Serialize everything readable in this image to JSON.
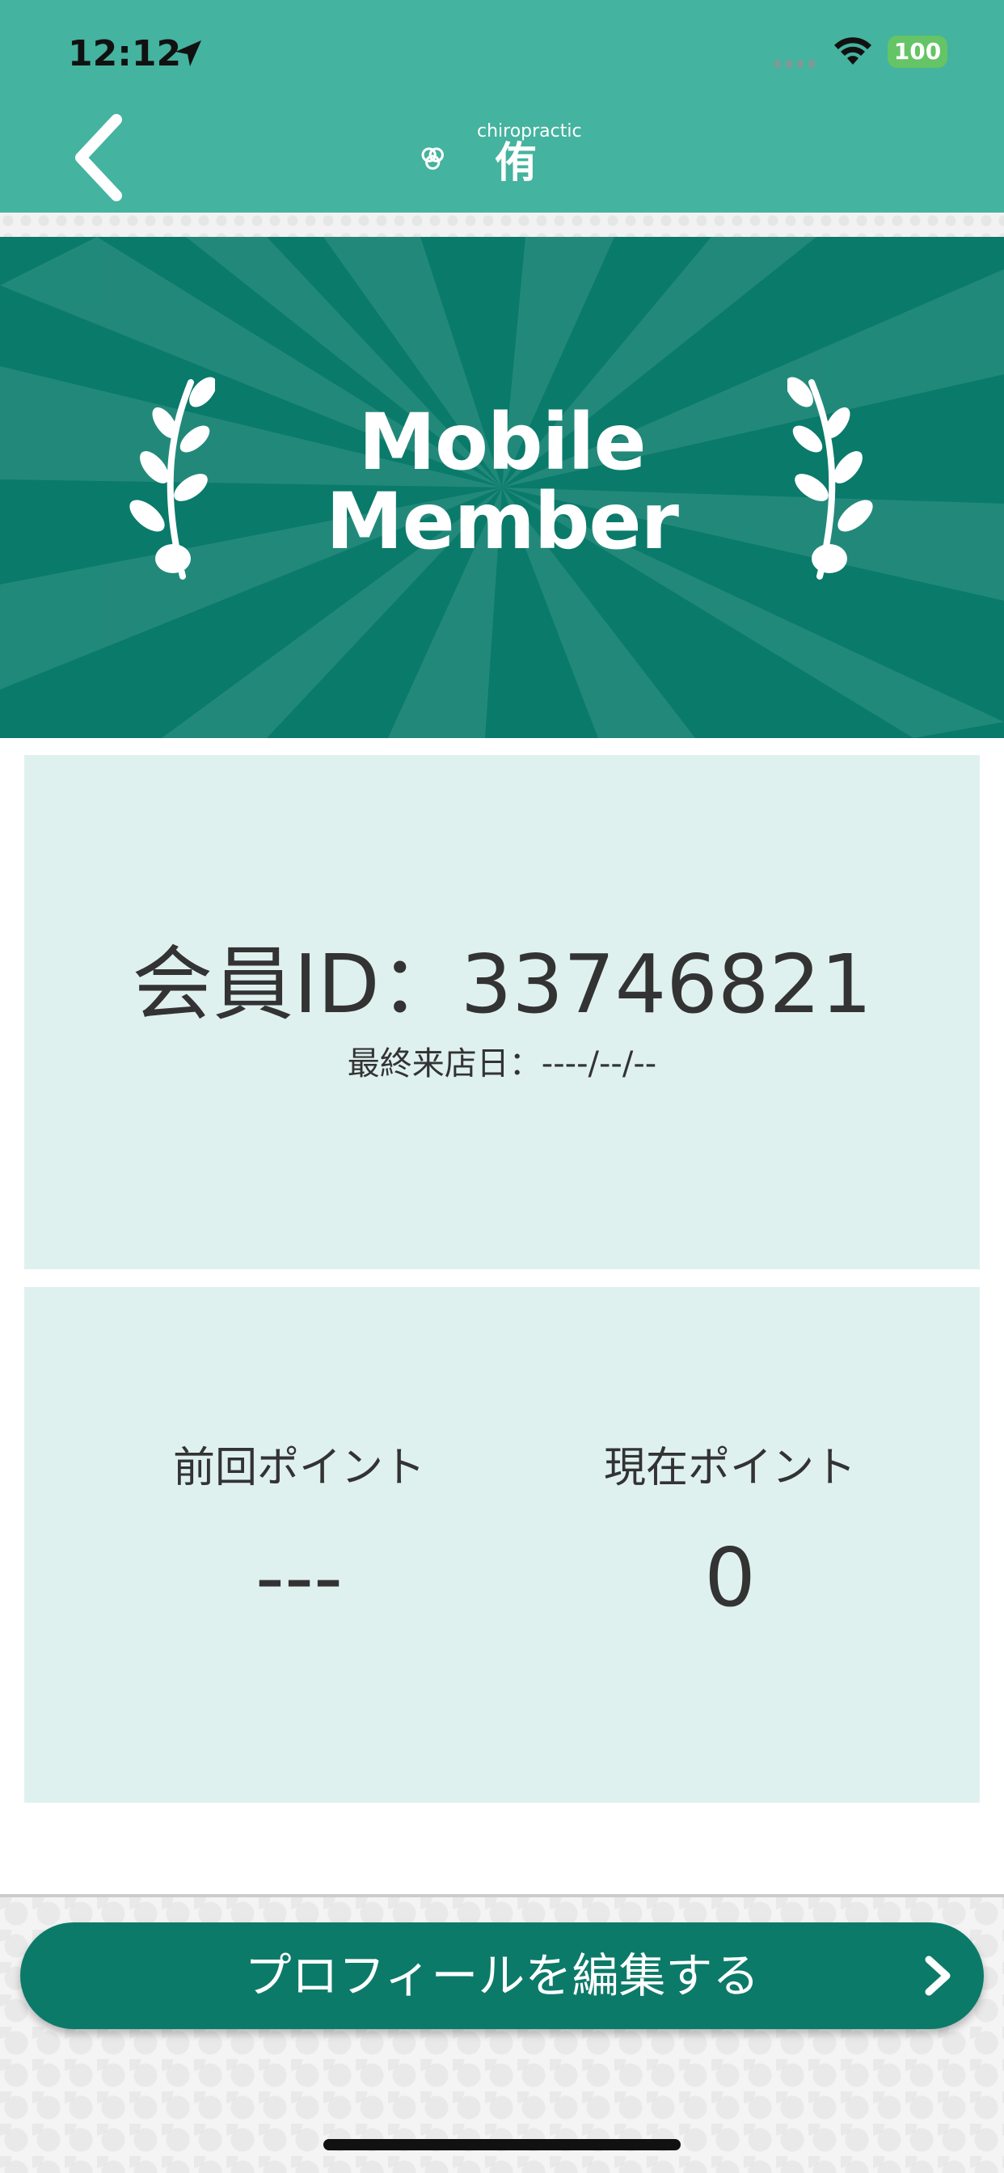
{
  "status_bar": {
    "time": "12:12",
    "battery": "100",
    "location_icon": "location-arrow-icon",
    "wifi_icon": "wifi-icon",
    "signal_icon": "cellular-signal-icon"
  },
  "nav": {
    "back_icon": "chevron-left-icon",
    "logo_sub": "chiropractic",
    "logo_main": "侑"
  },
  "banner": {
    "title_line1": "Mobile",
    "title_line2": "Member",
    "laurel_icon": "laurel-branch-icon"
  },
  "member_card": {
    "member_id": "会員ID：33746821",
    "last_visit": "最終来店日：----/--/--"
  },
  "points": {
    "previous_label": "前回ポイント",
    "previous_value": "---",
    "current_label": "現在ポイント",
    "current_value": "0"
  },
  "footer": {
    "edit_profile_label": "プロフィールを編集する",
    "chevron_icon": "chevron-right-icon"
  },
  "colors": {
    "header_bg": "#44b39f",
    "banner_bg": "#0a7a6a",
    "card_bg": "#dff1ef",
    "button_bg": "#0c7a69"
  }
}
